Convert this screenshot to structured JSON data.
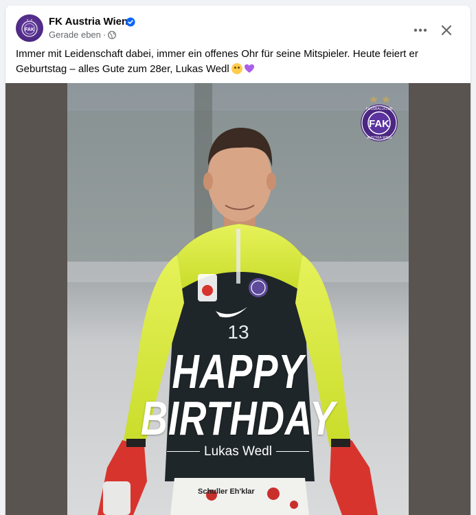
{
  "post": {
    "author": "FK Austria Wien",
    "timestamp": "Gerade eben",
    "separator": "·",
    "text": "Immer mit Leidenschaft dabei, immer ein offenes Ohr für seine Mitspieler. Heute feiert er Geburtstag – alles Gute zum 28er, Lukas Wedl",
    "icons": {
      "verified": "verified-badge-icon",
      "audience": "globe-icon",
      "more": "more-options-icon",
      "close": "close-icon"
    }
  },
  "graphic": {
    "line1": "HAPPY",
    "line2": "BIRTHDAY",
    "player_name": "Lukas Wedl",
    "shirt_number": "13",
    "badge_ring_top": "FUSSBALLKLUB",
    "badge_ring_bottom": "AUSTRIA WIEN",
    "badge_letters": "FAK",
    "sponsor": "Schuller Eh'klar"
  },
  "colors": {
    "brand_purple": "#4b2781",
    "verified_blue": "#0866ff",
    "jersey_yellow": "#d4e83a",
    "jersey_dark": "#1f2629",
    "media_bg": "#595450"
  }
}
